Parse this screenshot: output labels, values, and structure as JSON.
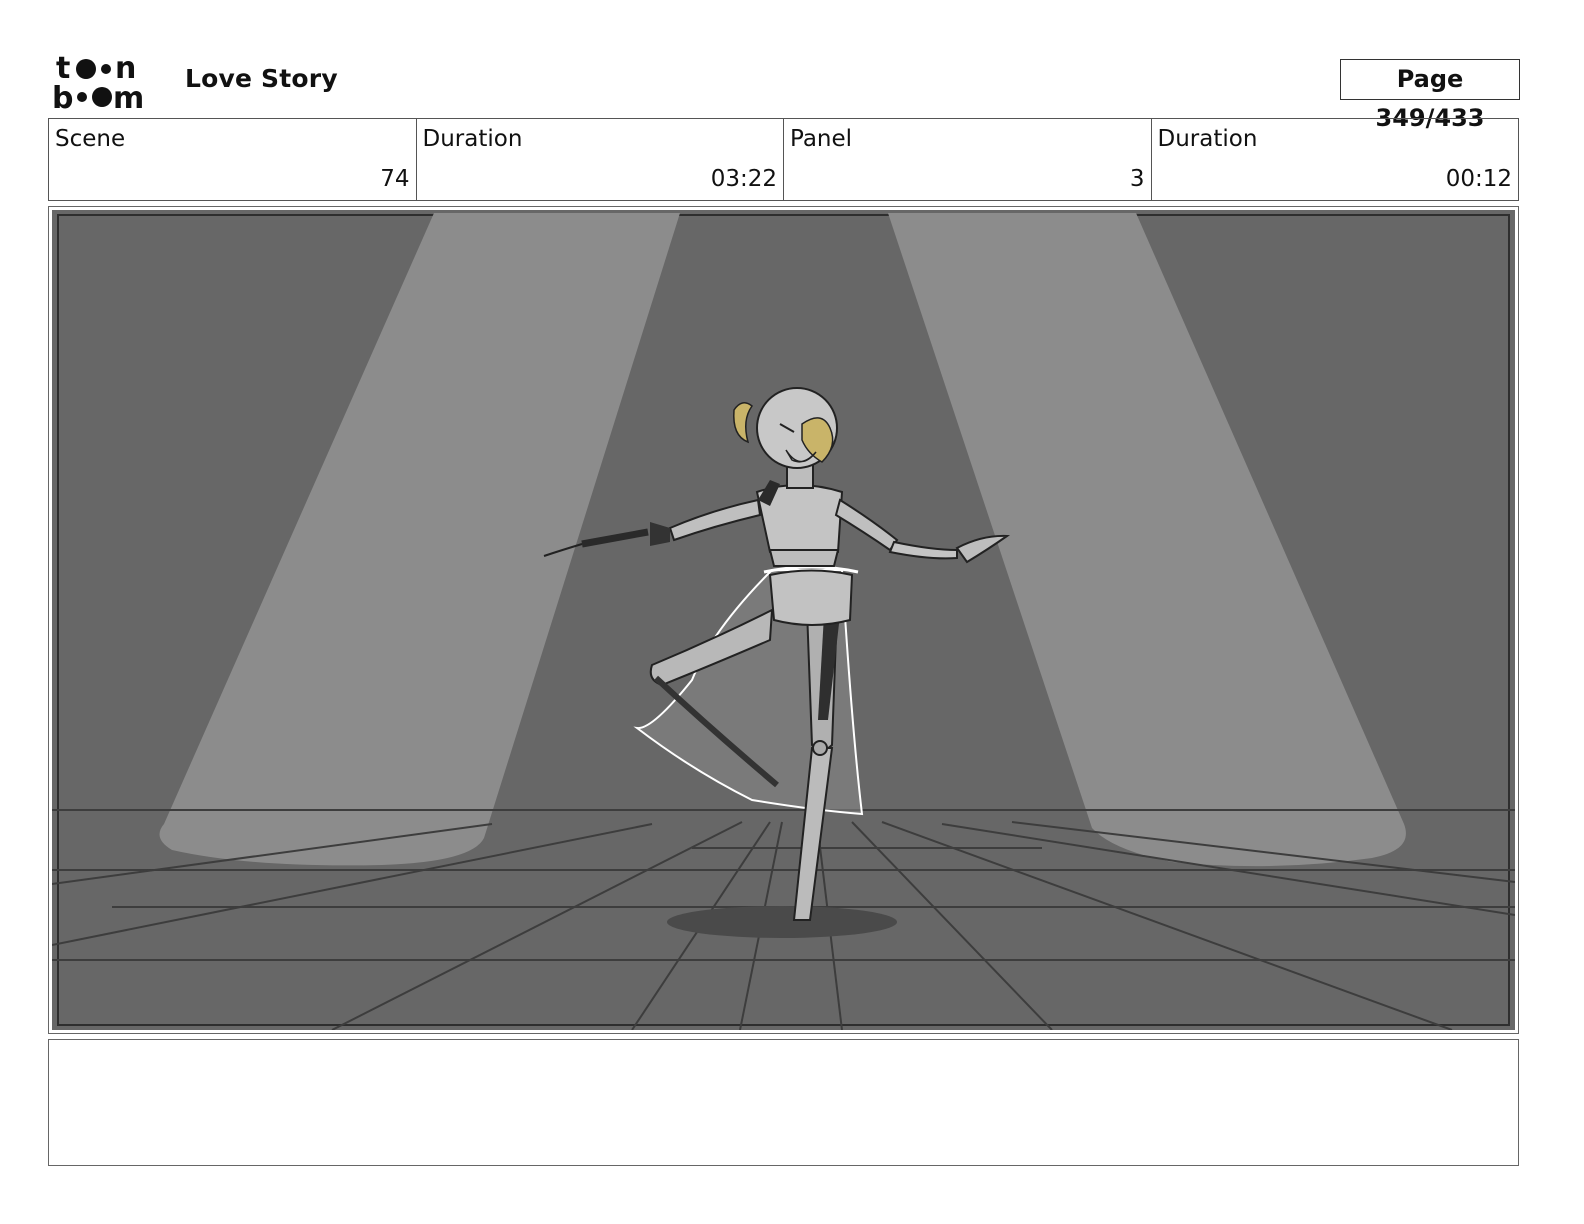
{
  "header": {
    "logo_icon": "toonboom-logo-icon",
    "title": "Love Story",
    "page": "Page 349/433"
  },
  "info": [
    {
      "label": "Scene",
      "value": "74"
    },
    {
      "label": "Duration",
      "value": "03:22"
    },
    {
      "label": "Panel",
      "value": "3"
    },
    {
      "label": "Duration",
      "value": "00:12"
    }
  ],
  "panel": {
    "description_icon": "dancer-on-stage-sketch",
    "colors": {
      "background": "#676767",
      "spotlight": "#8c8c8c",
      "floor_lines": "#3a3a3a",
      "hair": "#c9b469",
      "figure": "#bdbdbd"
    }
  },
  "notes": {
    "text": ""
  }
}
